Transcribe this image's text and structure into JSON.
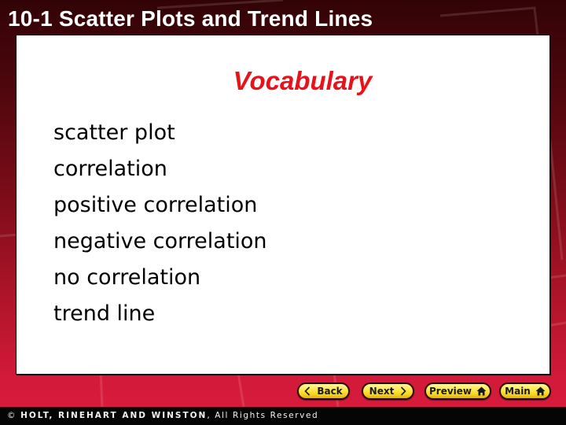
{
  "slide": {
    "title": "10-1 Scatter Plots and Trend Lines",
    "heading": "Vocabulary",
    "terms": [
      "scatter plot",
      "correlation",
      "positive correlation",
      "negative correlation",
      "no correlation",
      "trend line"
    ]
  },
  "navigation": {
    "back_label": "Back",
    "next_label": "Next",
    "preview_label": "Preview",
    "main_label": "Main",
    "icons": {
      "back": "chevron-left-icon",
      "next": "chevron-right-icon",
      "preview": "home-icon",
      "main": "home-icon"
    }
  },
  "footer": {
    "copyright_symbol": "©",
    "publisher": "HOLT, RINEHART AND WINSTON",
    "rights": ", All Rights Reserved"
  },
  "colors": {
    "heading": "#e8121a",
    "background_top": "#320306",
    "background_bottom": "#d81c3d",
    "button_fill": "#ffe94a",
    "footer_bar": "#050505"
  }
}
